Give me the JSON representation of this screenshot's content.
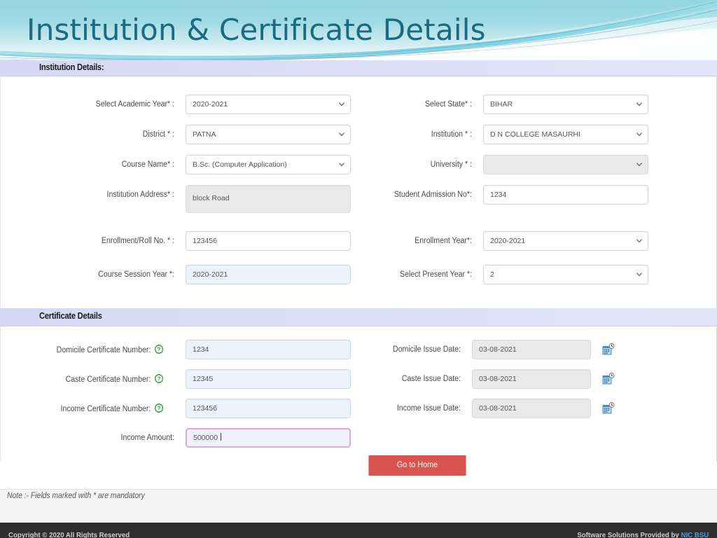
{
  "banner": {
    "title": "Institution & Certificate Details",
    "title_color": "#1a6b7d",
    "gradient_from": "#9fd9e2",
    "gradient_to": "#f2fbfc"
  },
  "institution_section": {
    "heading": "Institution Details:",
    "left_fields": [
      {
        "label": "Select Academic Year* :",
        "value": "2020-2021",
        "type": "select",
        "state": "normal"
      },
      {
        "label": "District * :",
        "value": "PATNA",
        "type": "select",
        "state": "normal"
      },
      {
        "label": "Course Name* :",
        "value": "B.Sc. (Computer Application)",
        "type": "select",
        "state": "normal"
      },
      {
        "label": "Institution Address* :",
        "value": "block Road",
        "type": "textarea",
        "state": "disabled"
      },
      {
        "label": "Enrollment/Roll No. * :",
        "value": "123456",
        "type": "text",
        "state": "normal"
      },
      {
        "label": "Course Session Year *:",
        "value": "2020-2021",
        "type": "text",
        "state": "filled"
      }
    ],
    "right_fields": [
      {
        "label": "Select State* :",
        "value": "BIHAR",
        "type": "select",
        "state": "normal"
      },
      {
        "label": "Institution * :",
        "value": "D N COLLEGE MASAURHI",
        "type": "select",
        "state": "normal"
      },
      {
        "label": "University * :",
        "value": "",
        "type": "select",
        "state": "disabled"
      },
      {
        "label": "Student Admission No*:",
        "value": "1234",
        "type": "text",
        "state": "normal"
      },
      {
        "label": "Enrollment Year*:",
        "value": "2020-2021",
        "type": "select",
        "state": "normal"
      },
      {
        "label": "Select Present Year *:",
        "value": "2",
        "type": "select",
        "state": "normal"
      }
    ]
  },
  "certificate_section": {
    "heading": "Certificate Details",
    "left_fields": [
      {
        "label": "Domicile Certificate Number:",
        "value": "1234",
        "type": "text",
        "state": "filled",
        "help_icon": "question-mark-icon"
      },
      {
        "label": "Caste Certificate Number:",
        "value": "12345",
        "type": "text",
        "state": "filled",
        "help_icon": "question-mark-icon"
      },
      {
        "label": "Income Certificate Number:",
        "value": "123456",
        "type": "text",
        "state": "filled",
        "help_icon": "question-mark-icon"
      },
      {
        "label": "Income Amount:",
        "value": "500000",
        "type": "text",
        "state": "focused",
        "help_icon": ""
      }
    ],
    "right_fields": [
      {
        "label": "Domicile Issue Date:",
        "value": "03-08-2021",
        "type": "date",
        "state": "disabled",
        "picker_icon": "calendar-icon"
      },
      {
        "label": "Caste Issue Date:",
        "value": "03-08-2021",
        "type": "date",
        "state": "disabled",
        "picker_icon": "calendar-icon"
      },
      {
        "label": "Income Issue Date:",
        "value": "03-08-2021",
        "type": "date",
        "state": "disabled",
        "picker_icon": "calendar-icon"
      }
    ]
  },
  "actions": {
    "home_button": "Go to Home",
    "home_button_color": "#d9534f"
  },
  "note": "Note :- Fields marked with * are mandatory",
  "footer": {
    "copyright": "Copyright © 2020 All Rights Reserved",
    "provider_prefix": "Software Solutions Provided by ",
    "provider_name": "NIC BSU"
  }
}
